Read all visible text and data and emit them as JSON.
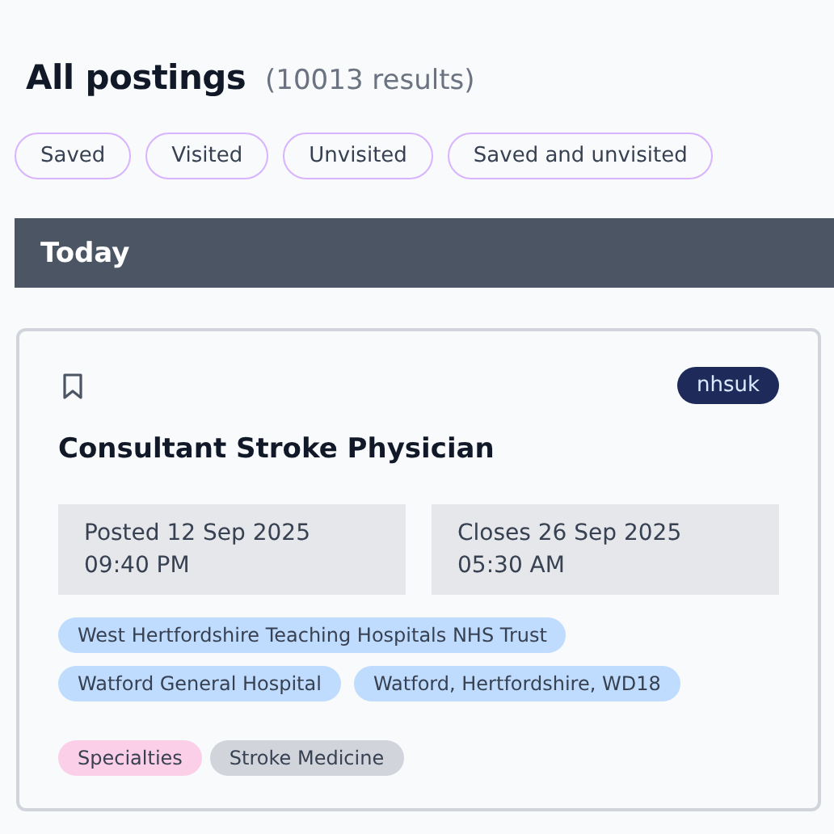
{
  "heading": {
    "title": "All postings",
    "count": "(10013 results)"
  },
  "filters": [
    {
      "label": "Saved",
      "selected": false
    },
    {
      "label": "Visited",
      "selected": false
    },
    {
      "label": "Unvisited",
      "selected": false
    },
    {
      "label": "Saved and unvisited",
      "selected": false
    }
  ],
  "section": {
    "title": "Today"
  },
  "postings": [
    {
      "saved": false,
      "source": "nhsuk",
      "title": "Consultant Stroke Physician",
      "posted": "Posted 12 Sep 2025 09:40 PM",
      "closes": "Closes 26 Sep 2025 05:30 AM",
      "locations": [
        "West Hertfordshire Teaching Hospitals NHS Trust",
        "Watford General Hospital",
        "Watford, Hertfordshire, WD18"
      ],
      "categories": [
        {
          "label": "Specialties",
          "values": [
            "Stroke Medicine"
          ]
        }
      ]
    }
  ]
}
